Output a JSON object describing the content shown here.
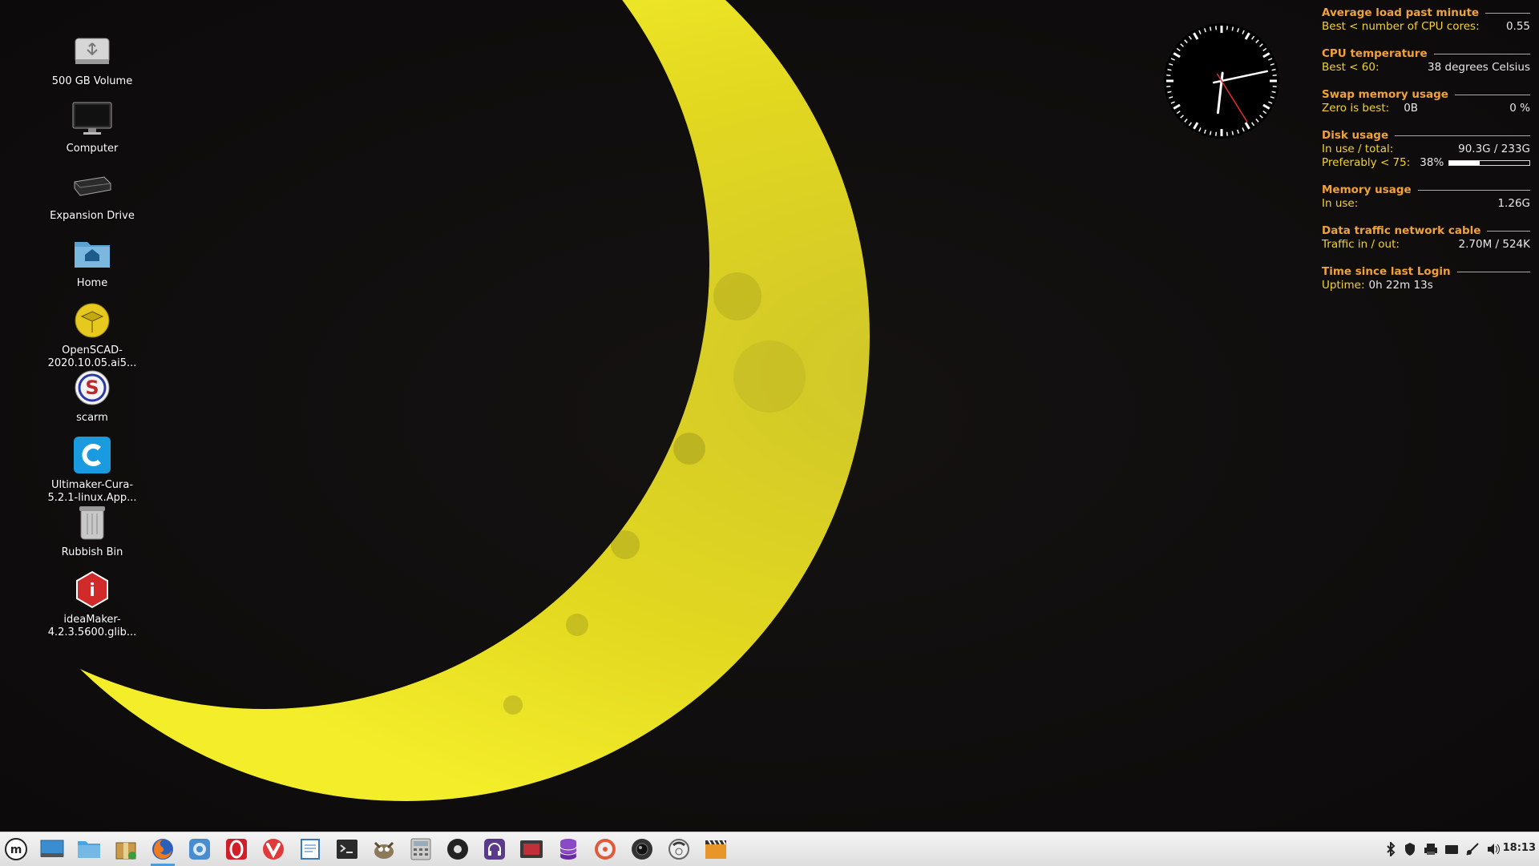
{
  "desktop": {
    "icons": [
      {
        "label": "500 GB Volume",
        "icon": "usb-drive-icon"
      },
      {
        "label": "Computer",
        "icon": "computer-icon"
      },
      {
        "label": "Expansion Drive",
        "icon": "external-drive-icon"
      },
      {
        "label": "Home",
        "icon": "home-folder-icon"
      },
      {
        "label": "OpenSCAD-\n2020.10.05.ai5...",
        "icon": "openscad-icon"
      },
      {
        "label": "scarm",
        "icon": "scarm-icon"
      },
      {
        "label": "Ultimaker-Cura-\n5.2.1-linux.App...",
        "icon": "cura-icon"
      },
      {
        "label": "Rubbish Bin",
        "icon": "trash-icon"
      },
      {
        "label": "ideaMaker-\n4.2.3.5600.glib...",
        "icon": "ideamaker-icon"
      }
    ]
  },
  "conky": {
    "load": {
      "title": "Average load past minute",
      "label": "Best < number of CPU cores:",
      "value": "0.55"
    },
    "cpu": {
      "title": "CPU temperature",
      "label": "Best < 60:",
      "value": "38  degrees Celsius"
    },
    "swap": {
      "title": "Swap memory usage",
      "label": "Zero is best:",
      "amount": "0B",
      "percent": "0 %"
    },
    "disk": {
      "title": "Disk usage",
      "label1": "In use / total:",
      "value1": "90.3G / 233G",
      "label2": "Preferably < 75:",
      "percent": "38%",
      "fraction": 0.38
    },
    "memory": {
      "title": "Memory usage",
      "label": "In use:",
      "value": "1.26G"
    },
    "network": {
      "title": "Data traffic network cable",
      "label": "Traffic in / out:",
      "value": "2.70M  /  524K"
    },
    "uptime": {
      "title": "Time since last Login",
      "label": "Uptime:",
      "value": "0h 22m 13s"
    }
  },
  "taskbar": {
    "apps": [
      "menu-icon",
      "show-desktop-icon",
      "files-icon",
      "package-icon",
      "firefox-icon",
      "chromium-icon",
      "opera-icon",
      "vivaldi-icon",
      "text-editor-icon",
      "terminal-icon",
      "gimp-icon",
      "calculator-icon",
      "audio-player-icon",
      "headphones-icon",
      "screenshot-icon",
      "database-icon",
      "disk-burner-icon",
      "camera-icon",
      "phone-icon",
      "video-editor-icon"
    ],
    "tray": [
      "bluetooth-icon",
      "shield-icon",
      "printer-icon",
      "keyboard-icon",
      "network-icon",
      "volume-icon"
    ],
    "time": "18:13"
  },
  "colors": {
    "conky_heading": "#f0a23a",
    "conky_label": "#f2d230",
    "moon": "#e8e11e"
  }
}
